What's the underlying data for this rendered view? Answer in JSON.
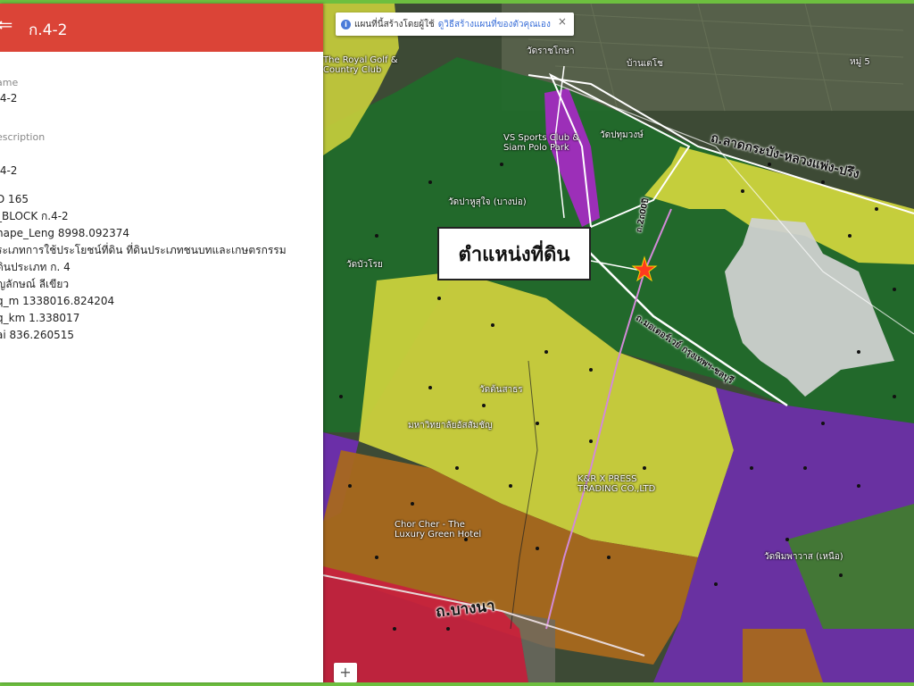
{
  "panel": {
    "title": "ก.4-2",
    "name_label": "ame",
    "name_value": ".4-2",
    "description_label": "escription",
    "description_lines": [
      ".4-2",
      "",
      "D 165",
      "_BLOCK ก.4-2",
      "hape_Leng 8998.092374",
      "ระเภทการใช้ประโยชน์ที่ดิน ที่ดินประเภทชนบทและเกษตรกรรม",
      "ดินประเภท ก. 4",
      "ญลักษณ์ ลีเขียว",
      "q_m 1338016.824204",
      "q_km 1.338017",
      "ai 836.260515"
    ]
  },
  "map": {
    "banner_text": "แผนที่นี้สร้างโดยผู้ใช้",
    "banner_link": "ดูวิธีสร้างแผนที่ของตัวคุณเอง",
    "callout": "ตำแหน่งที่ดิน",
    "road_top": "ถ.ลาดกระบัง-หลวงแพ่ง-ปรึง",
    "road_mid": "ถ.มอเตอร์เวย์ กรุงเทพฯ-ชลบุรี",
    "road_bottom": "ถ.บางนา",
    "road_small": "ถ.2ถ00ปี",
    "places": [
      "วัดบัวโรย",
      "The Royal Golf & Country Club",
      "VS Sports Club & Siam Polo Park",
      "วัดปทุมวงษ์",
      "วัดปาหูสุใจ (บางบ่อ)",
      "วัดต้นสาธร",
      "มหาวิทยาลัยอัสสัมชัญ",
      "K&R X PRESS TRADING CO.,LTD",
      "Chor Cher - The Luxury Green Hotel",
      "วัดพิมพาวาส (เหนือ)",
      "หมู่ 5",
      "วัดราชโกษา",
      "บ้านเตโช"
    ],
    "zoom_in": "+",
    "colors": {
      "agri_green": "#1f6b2a",
      "yellow": "#c9cf3c",
      "purple": "#6b2fa8",
      "magenta": "#9c2fb8",
      "orange": "#a8681e",
      "red": "#c8203e",
      "marker": "#ff3b1f",
      "header": "#db4437"
    }
  }
}
